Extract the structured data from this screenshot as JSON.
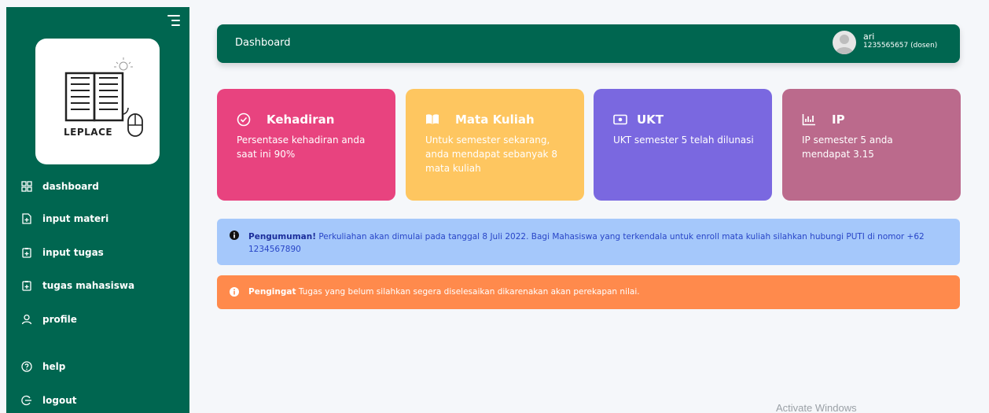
{
  "sidebar": {
    "logo_text": "LEPLACE",
    "items": [
      {
        "label": "dashboard",
        "icon": "grid-icon"
      },
      {
        "label": "input materi",
        "icon": "file-plus-icon"
      },
      {
        "label": "input tugas",
        "icon": "clipboard-plus-icon"
      },
      {
        "label": "tugas mahasiswa",
        "icon": "clipboard-plus-icon"
      },
      {
        "label": "profile",
        "icon": "user-icon"
      },
      {
        "label": "help",
        "icon": "help-circle-icon"
      },
      {
        "label": "logout",
        "icon": "logout-icon"
      }
    ]
  },
  "header": {
    "title": "Dashboard",
    "user_name": "ari",
    "user_id": "1235565657 (dosen)"
  },
  "cards": [
    {
      "title": "Kehadiran",
      "body": "Persentase kehadiran anda saat ini 90%",
      "icon": "check-circle-icon",
      "color": "#e8437f"
    },
    {
      "title": "Mata Kuliah",
      "body": "Untuk semester sekarang, anda mendapat sebanyak 8 mata kuliah",
      "icon": "book-icon",
      "color": "#fec660"
    },
    {
      "title": "UKT",
      "body": "UKT semester 5 telah dilunasi",
      "icon": "money-icon",
      "color": "#7a68e0"
    },
    {
      "title": "IP",
      "body": "IP semester 5 anda mendapat 3.15",
      "icon": "chart-icon",
      "color": "#bb6a8c"
    }
  ],
  "alerts": {
    "info_label": "Pengumuman!",
    "info_text": " Perkuliahan akan dimulai pada tanggal 8 Juli 2022. Bagi Mahasiswa yang terkendala untuk enroll mata kuliah silahkan hubungi PUTI di nomor +62 1234567890",
    "warn_label": "Pengingat",
    "warn_text": " Tugas yang belum silahkan segera diselesaikan dikarenakan akan perekapan nilai."
  },
  "watermark": "Activate Windows",
  "colors": {
    "primary": "#006650",
    "info_bg": "#a5c8fb",
    "warn_bg": "#ff8a4c"
  }
}
